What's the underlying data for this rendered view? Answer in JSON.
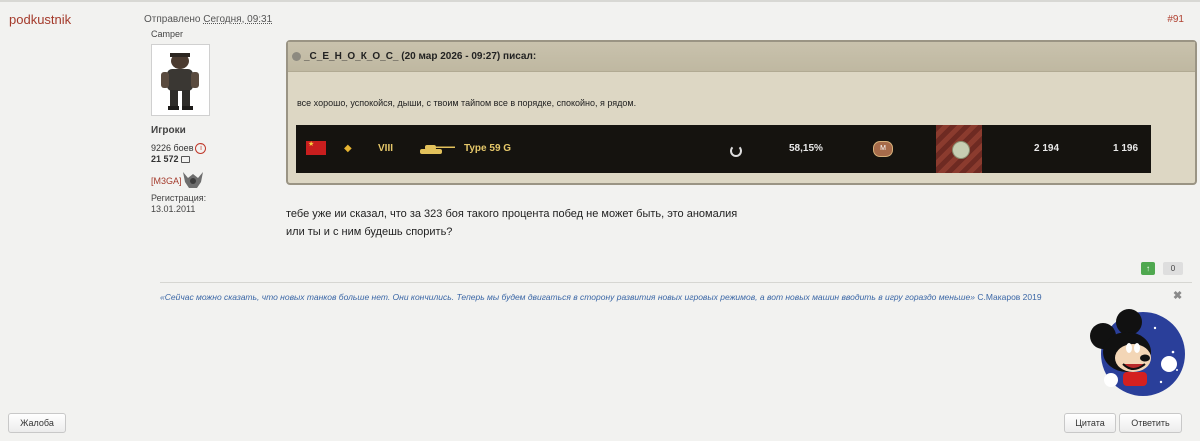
{
  "post": {
    "author": "podkustnik",
    "posted_prefix": "Отправлено",
    "posted_date": "Сегодня, 09:31",
    "number": "#91",
    "text_lines": [
      "тебе уже ии сказал, что за 323 боя такого процента побед не может быть, это аномалия",
      "или ты и с ним будешь спорить?"
    ]
  },
  "user": {
    "title": "Camper",
    "group": "Игроки",
    "battles": "9226 боев",
    "posts": "21 572",
    "clan": "[M3GA]",
    "reg_label": "Регистрация:",
    "reg_date": "13.01.2011"
  },
  "quote": {
    "header": "_С_Е_Н_О_К_О_С_ (20 мар 2026 - 09:27) писал:",
    "text": "все хорошо, успокойся, дыши, с твоим тайпом все в порядке, спокойно, я рядом.",
    "tank": {
      "tier": "VIII",
      "name": "Type 59 G",
      "winrate": "58,15%",
      "value1": "2 194",
      "value2": "1 196"
    }
  },
  "votes": {
    "up": "↑",
    "count": "0"
  },
  "signature": {
    "text": "«Сейчас можно сказать, что новых танков больше нет. Они кончились. Теперь мы будем двигаться в сторону развития новых игровых режимов, а вот новых машин вводить в игру гораздо меньше»",
    "author": "С.Макаров 2019",
    "close": "✖"
  },
  "buttons": {
    "complaint": "Жалоба",
    "quote": "Цитата",
    "reply": "Ответить"
  },
  "colors": {
    "author": "#a43a2b",
    "signature": "#3b67a6",
    "quote_bg": "#ddd7c4",
    "tank_bar_bg": "#15130f",
    "tank_text": "#e6c86a"
  }
}
